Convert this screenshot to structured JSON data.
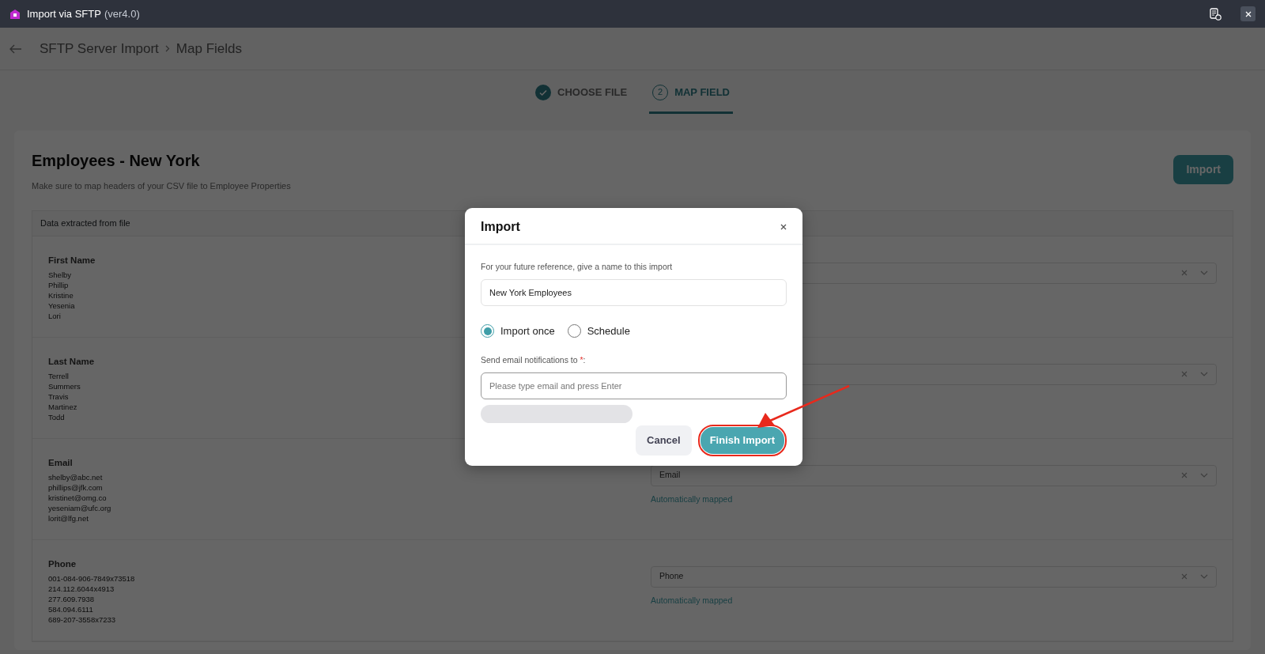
{
  "window": {
    "title": "Import via SFTP",
    "version": "(ver4.0)"
  },
  "breadcrumb": [
    "SFTP Server Import",
    "Map Fields"
  ],
  "steps": [
    {
      "label": "CHOOSE FILE",
      "done": true,
      "selected": false
    },
    {
      "label": "MAP FIELD",
      "number": "2",
      "done": false,
      "selected": true
    }
  ],
  "card": {
    "title": "Employees - New York",
    "subtitle": "Make sure to map headers of your CSV file to Employee Properties",
    "import_button": "Import"
  },
  "table": {
    "column_1": "Data extracted from file",
    "rows": [
      {
        "field": "First Name",
        "values": [
          "Shelby",
          "Phillip",
          "Kristine",
          "Yesenia",
          "Lori"
        ]
      },
      {
        "field": "Last Name",
        "values": [
          "Terrell",
          "Summers",
          "Travis",
          "Martinez",
          "Todd"
        ]
      },
      {
        "field": "Email",
        "values": [
          "shelby@abc.net",
          "phillips@jfk.com",
          "kristinet@omg.co",
          "yeseniam@ufc.org",
          "lorit@lfg.net"
        ],
        "mapped_to": "Email",
        "note": "Automatically mapped"
      },
      {
        "field": "Phone",
        "values": [
          "001-084-906-7849x73518",
          "214.112.6044x4913",
          "277.609.7938",
          "584.094.6111",
          "689-207-3558x7233"
        ],
        "mapped_to": "Phone",
        "note": "Automatically mapped"
      }
    ]
  },
  "dialog": {
    "title": "Import",
    "name_label": "For your future reference, give a name to this import",
    "name_value": "New York Employees",
    "options": [
      {
        "label": "Import once",
        "selected": true
      },
      {
        "label": "Schedule",
        "selected": false
      }
    ],
    "email_label": "Send email notifications to ",
    "required_mark": "*",
    "label_suffix": ":",
    "email_placeholder": "Please type email and press Enter",
    "buttons": [
      {
        "label": "Cancel",
        "kind": "secondary",
        "highlighted": false
      },
      {
        "label": "Finish Import",
        "kind": "primary",
        "highlighted": true
      }
    ]
  }
}
